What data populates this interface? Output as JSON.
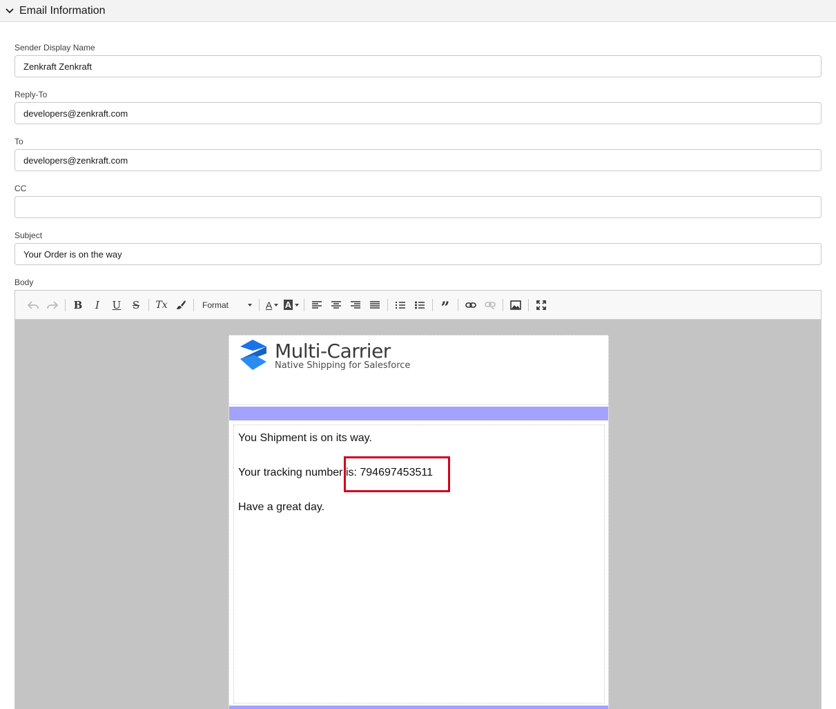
{
  "section": {
    "title": "Email Information"
  },
  "fields": {
    "sender_display_name": {
      "label": "Sender Display Name",
      "value": "Zenkraft Zenkraft"
    },
    "reply_to": {
      "label": "Reply-To",
      "value": "developers@zenkraft.com"
    },
    "to": {
      "label": "To",
      "value": "developers@zenkraft.com"
    },
    "cc": {
      "label": "CC",
      "value": ""
    },
    "subject": {
      "label": "Subject",
      "value": "Your Order is on the way"
    }
  },
  "body": {
    "label": "Body",
    "toolbar": {
      "format_label": "Format",
      "bold": "B",
      "italic": "I",
      "underline": "U",
      "strike": "S",
      "clear_format": "Tx",
      "font_color": "A",
      "bg_color": "A",
      "quote": "”"
    },
    "email": {
      "brand_name": "Multi-Carrier",
      "brand_tagline": "Native Shipping for Salesforce",
      "line1": "You Shipment is on its way.",
      "line2": "Your tracking number is: 794697453511",
      "line3": "Have a great day."
    }
  },
  "colors": {
    "accent_band": "#a3a3ff",
    "highlight": "#d0021b",
    "logo_blue": "#1a73e8"
  }
}
